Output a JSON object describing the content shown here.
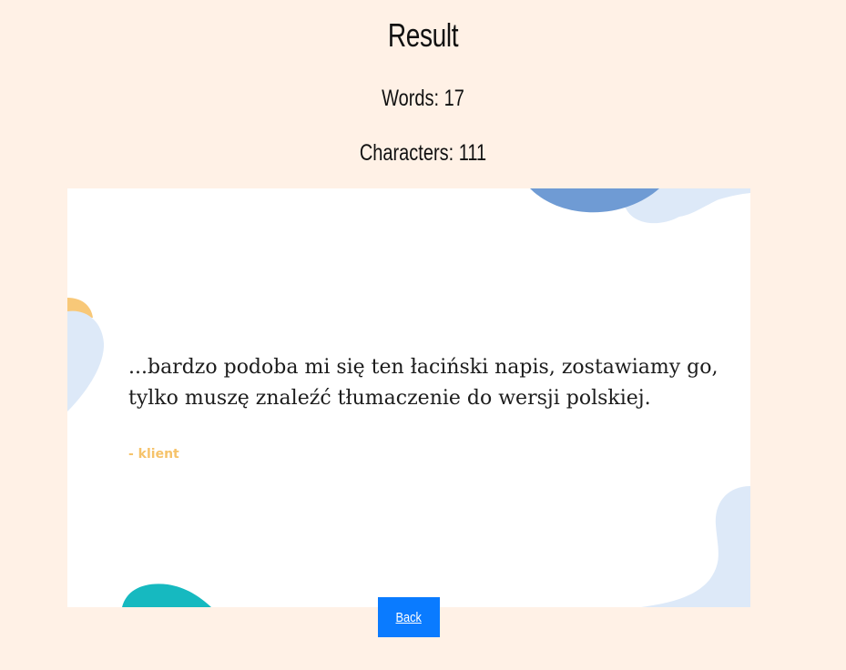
{
  "result": {
    "title": "Result",
    "words_label": "Words: 17",
    "characters_label": "Characters: 111"
  },
  "card": {
    "quote": "...bardzo podoba mi się ten łaciński napis, zostawiamy go, tylko muszę znaleźć tłumaczenie do wersji polskiej.",
    "author": "- klient"
  },
  "actions": {
    "back_label": "Back"
  },
  "colors": {
    "page_background": "#fff1e6",
    "card_background": "#ffffff",
    "author_text": "#f6c36a",
    "back_button": "#0a7bff",
    "blob_blue_dark": "#6f9bd4",
    "blob_blue_light": "#dde9f8",
    "blob_yellow": "#f8c878",
    "blob_teal": "#16b9c0"
  }
}
